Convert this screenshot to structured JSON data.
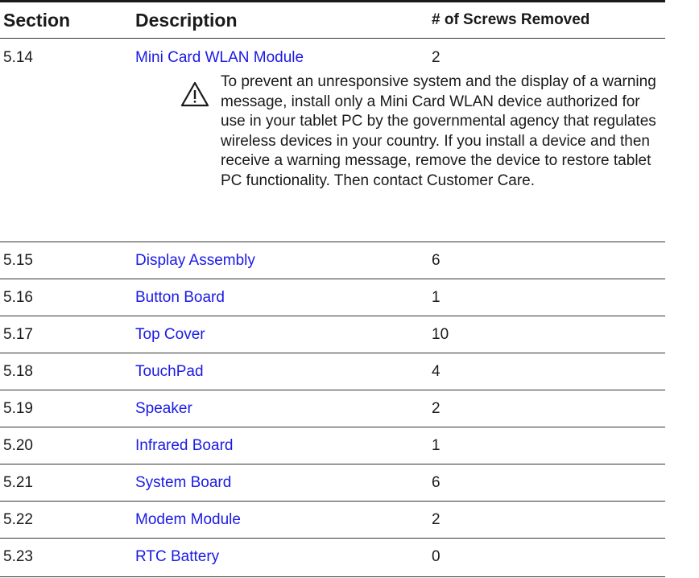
{
  "table": {
    "headers": {
      "section": "Section",
      "description": "Description",
      "screws": "# of Screws Removed"
    },
    "first_row": {
      "section": "5.14",
      "description": "Mini Card WLAN Module",
      "screws": "2"
    },
    "caution_text": "To prevent an unresponsive system and the display of a warning message, install only a Mini Card WLAN device authorized for use in your tablet PC by the governmental agency that regulates wireless devices in your country. If you install a device and then receive a warning message, remove the device to restore tablet PC functionality. Then contact Customer Care.",
    "rows": [
      {
        "section": "5.15",
        "description": "Display Assembly",
        "screws": "6"
      },
      {
        "section": "5.16",
        "description": "Button Board",
        "screws": "1"
      },
      {
        "section": "5.17",
        "description": "Top Cover",
        "screws": "10"
      },
      {
        "section": "5.18",
        "description": "TouchPad",
        "screws": "4"
      },
      {
        "section": "5.19",
        "description": "Speaker",
        "screws": "2"
      },
      {
        "section": "5.20",
        "description": "Infrared Board",
        "screws": "1"
      },
      {
        "section": "5.21",
        "description": "System Board",
        "screws": "6"
      },
      {
        "section": "5.22",
        "description": "Modem Module",
        "screws": "2"
      },
      {
        "section": "5.23",
        "description": "RTC Battery",
        "screws": "0"
      }
    ]
  },
  "colors": {
    "link": "#1a1ae6",
    "text": "#1a1a1a",
    "rule": "#1a1a1a"
  },
  "icons": {
    "caution": "warning-triangle-icon"
  }
}
